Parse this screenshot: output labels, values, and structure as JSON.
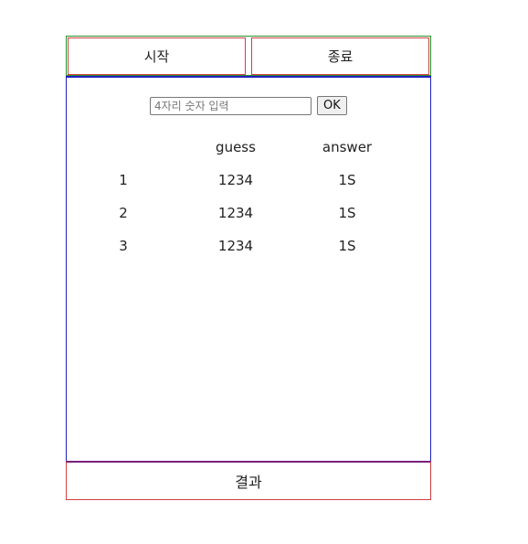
{
  "topbar": {
    "start_label": "시작",
    "end_label": "종료"
  },
  "input": {
    "placeholder": "4자리 숫자 입력",
    "value": "",
    "ok_label": "OK"
  },
  "table": {
    "headers": [
      "",
      "guess",
      "answer"
    ],
    "rows": [
      [
        "1",
        "1234",
        "1S"
      ],
      [
        "2",
        "1234",
        "1S"
      ],
      [
        "3",
        "1234",
        "1S"
      ]
    ]
  },
  "result": {
    "label": "결과"
  },
  "colors": {
    "topbar_border": "#2a8f2a",
    "button_border": "#d04040",
    "main_border": "#2020c0",
    "result_top_border": "#7a1f7a"
  }
}
